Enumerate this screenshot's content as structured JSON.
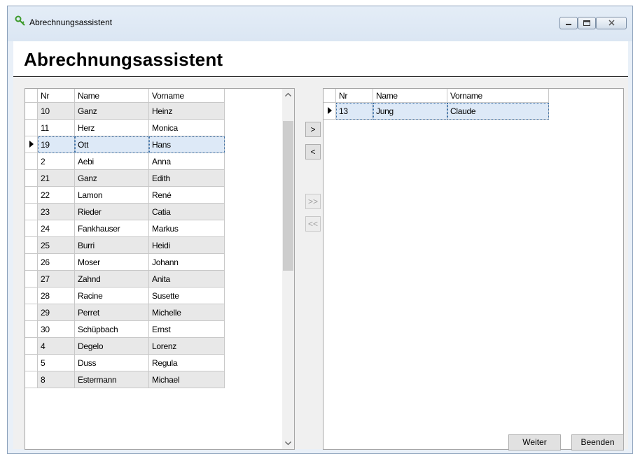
{
  "window": {
    "title": "Abrechnungsassistent",
    "heading": "Abrechnungsassistent"
  },
  "left_grid": {
    "columns": [
      "Nr",
      "Name",
      "Vorname"
    ],
    "rows": [
      {
        "nr": "10",
        "name": "Ganz",
        "vorname": "Heinz"
      },
      {
        "nr": "11",
        "name": "Herz",
        "vorname": "Monica"
      },
      {
        "nr": "19",
        "name": "Ott",
        "vorname": "Hans"
      },
      {
        "nr": "2",
        "name": "Aebi",
        "vorname": "Anna"
      },
      {
        "nr": "21",
        "name": "Ganz",
        "vorname": "Edith"
      },
      {
        "nr": "22",
        "name": "Lamon",
        "vorname": "René"
      },
      {
        "nr": "23",
        "name": "Rieder",
        "vorname": "Catia"
      },
      {
        "nr": "24",
        "name": "Fankhauser",
        "vorname": "Markus"
      },
      {
        "nr": "25",
        "name": "Burri",
        "vorname": "Heidi"
      },
      {
        "nr": "26",
        "name": "Moser",
        "vorname": "Johann"
      },
      {
        "nr": "27",
        "name": "Zahnd",
        "vorname": "Anita"
      },
      {
        "nr": "28",
        "name": "Racine",
        "vorname": "Susette"
      },
      {
        "nr": "29",
        "name": "Perret",
        "vorname": "Michelle"
      },
      {
        "nr": "30",
        "name": "Schüpbach",
        "vorname": "Ernst"
      },
      {
        "nr": "4",
        "name": "Degelo",
        "vorname": "Lorenz"
      },
      {
        "nr": "5",
        "name": "Duss",
        "vorname": "Regula"
      },
      {
        "nr": "8",
        "name": "Estermann",
        "vorname": "Michael"
      }
    ],
    "current_row_index": 2
  },
  "right_grid": {
    "columns": [
      "Nr",
      "Name",
      "Vorname"
    ],
    "rows": [
      {
        "nr": "13",
        "name": "Jung",
        "vorname": "Claude"
      }
    ],
    "current_row_index": 0
  },
  "move_buttons": {
    "add_one": ">",
    "remove_one": "<",
    "add_all": ">>",
    "remove_all": "<<"
  },
  "footer": {
    "next_label": "Weiter",
    "exit_label": "Beenden"
  },
  "icons": {
    "app_icon": "key-icon",
    "minimize": "minimize-icon",
    "maximize": "maximize-icon",
    "close": "close-icon",
    "scroll_up": "chevron-up-icon",
    "scroll_down": "chevron-down-icon"
  },
  "colors": {
    "accent": "#3a6ea5",
    "alt_row": "#e8e8e8",
    "selection": "#dde9f7"
  }
}
